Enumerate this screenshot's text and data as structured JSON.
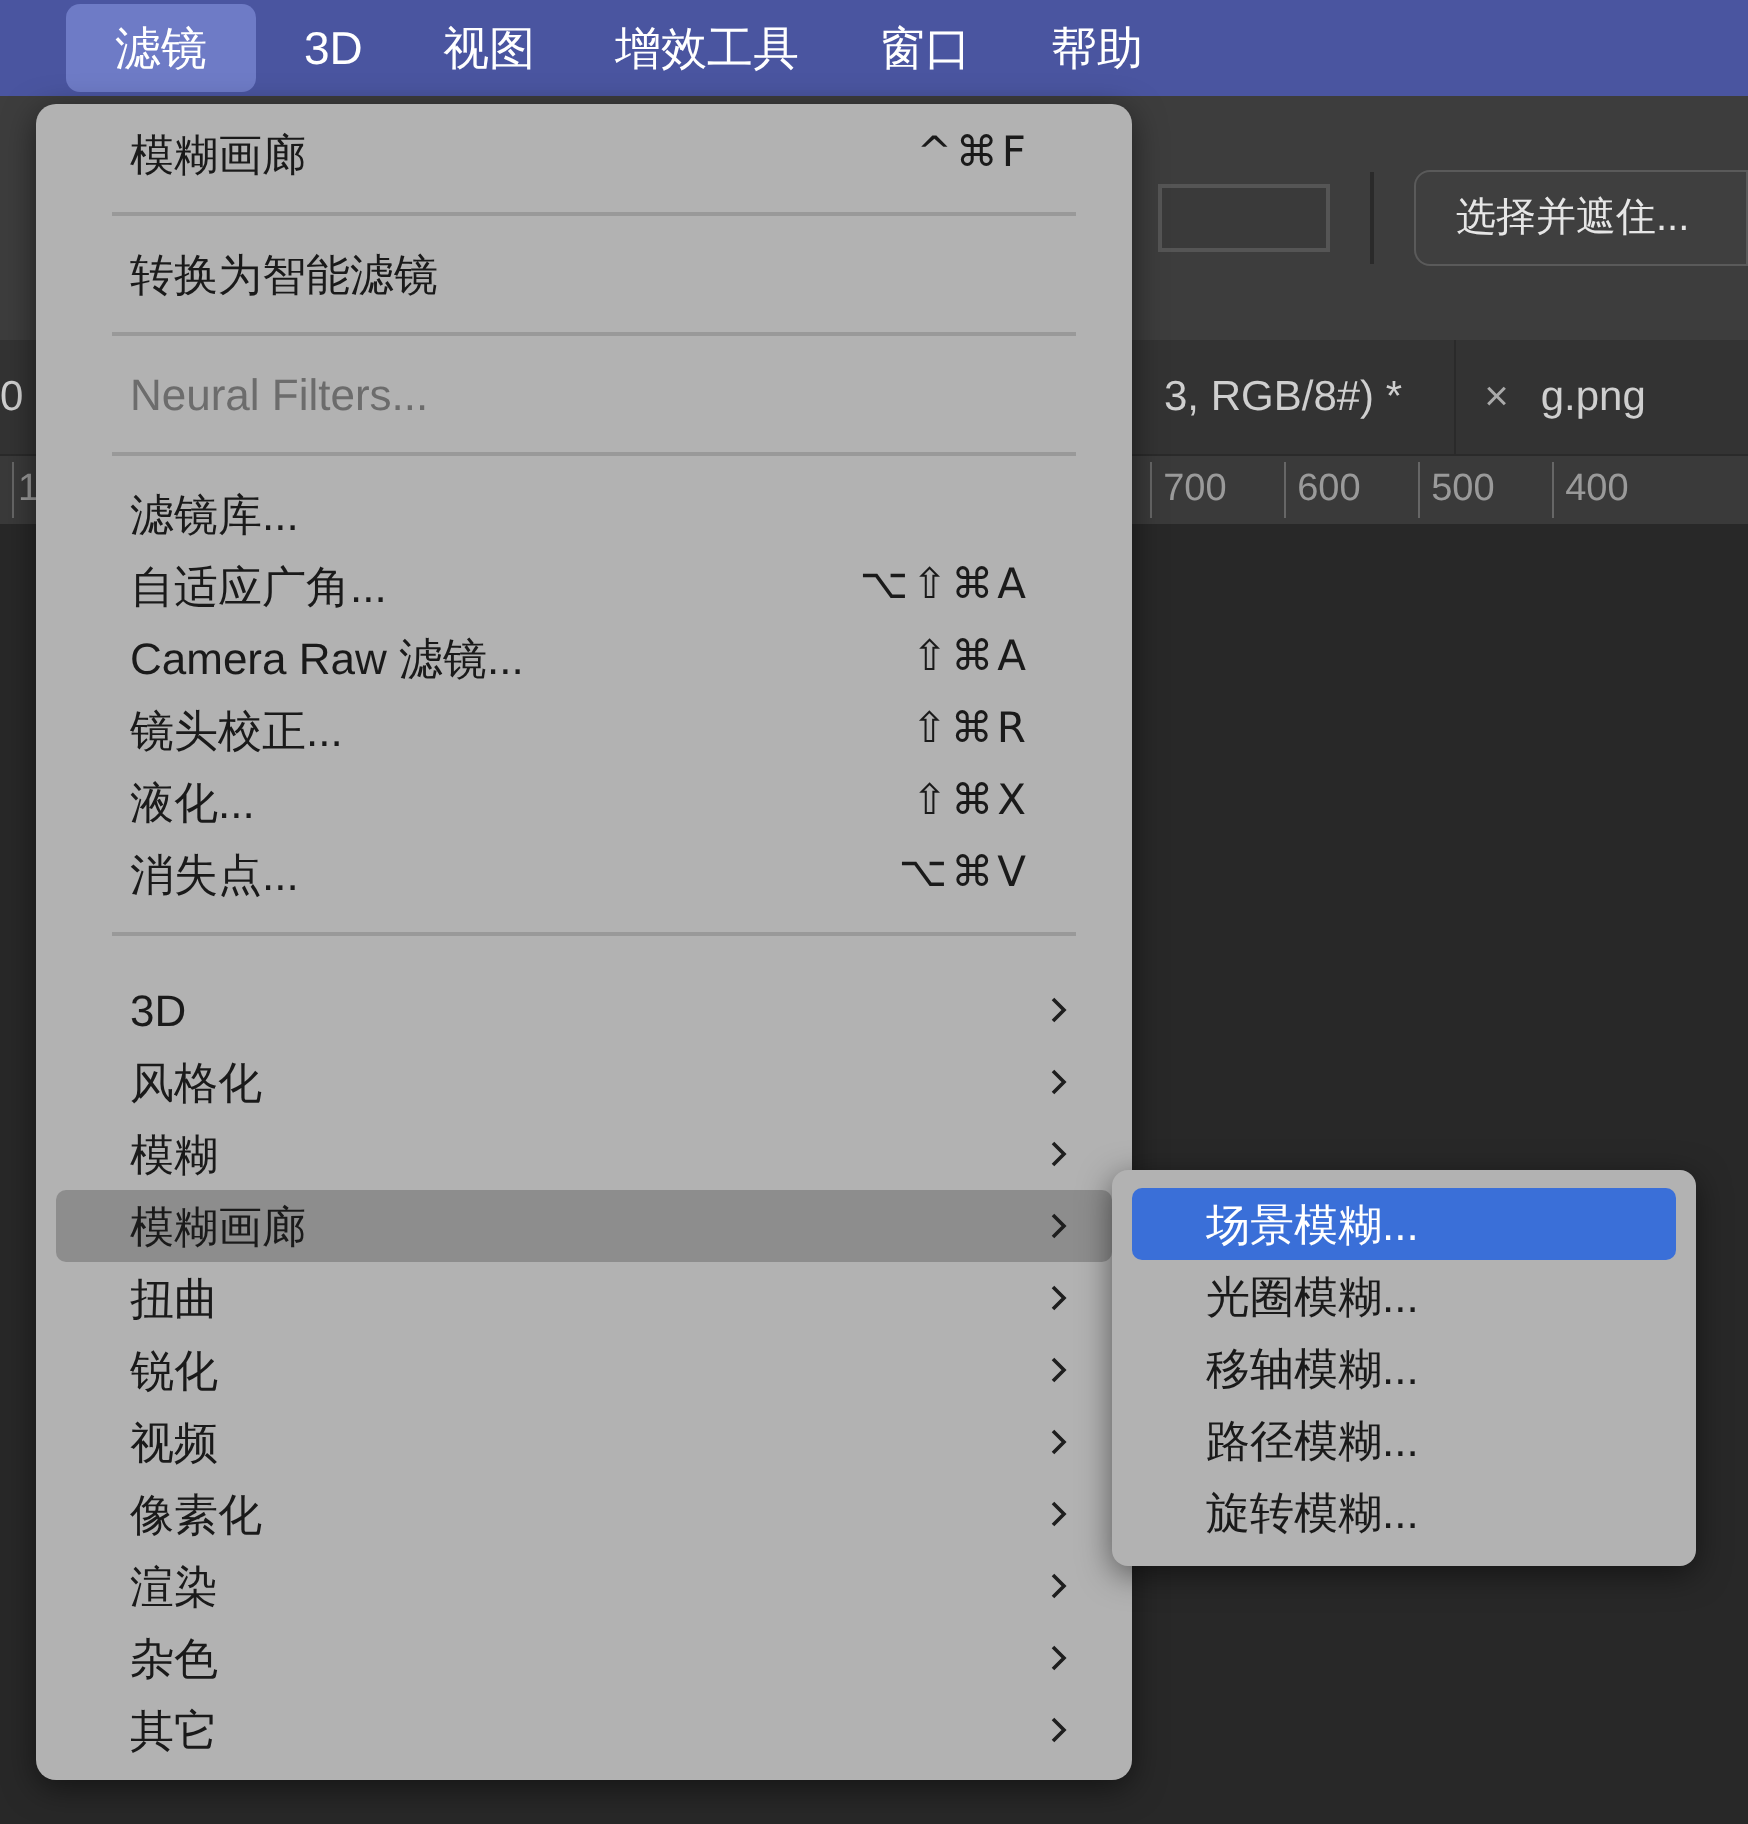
{
  "menu_bar": [
    {
      "label": "滤镜",
      "selected": true
    },
    {
      "label": "3D",
      "selected": false
    },
    {
      "label": "视图",
      "selected": false
    },
    {
      "label": "增效工具",
      "selected": false
    },
    {
      "label": "窗口",
      "selected": false
    },
    {
      "label": "帮助",
      "selected": false
    }
  ],
  "options_bar": {
    "button": "选择并遮住..."
  },
  "document_tabs": [
    {
      "label": "0"
    },
    {
      "label": "3, RGB/8#) *"
    },
    {
      "label": "g.png",
      "close": "×"
    }
  ],
  "ruler": {
    "labels": [
      "1",
      "700",
      "600",
      "500",
      "400"
    ]
  },
  "menu": {
    "sections": [
      [
        {
          "kind": "item",
          "label": "模糊画廊",
          "shortcut": "^⌘F",
          "disabled": false,
          "selected": false
        }
      ],
      [
        {
          "kind": "item",
          "label": "转换为智能滤镜",
          "disabled": false,
          "selected": false
        }
      ],
      [
        {
          "kind": "item",
          "label": "Neural Filters...",
          "disabled": true,
          "selected": false
        }
      ],
      [
        {
          "kind": "item",
          "label": "滤镜库...",
          "disabled": false,
          "selected": false
        },
        {
          "kind": "item",
          "label": "自适应广角...",
          "shortcut": "⌥⇧⌘A",
          "disabled": false,
          "selected": false
        },
        {
          "kind": "item",
          "label": "Camera Raw 滤镜...",
          "shortcut": "⇧⌘A",
          "disabled": false,
          "selected": false
        },
        {
          "kind": "item",
          "label": "镜头校正...",
          "shortcut": "⇧⌘R",
          "disabled": false,
          "selected": false
        },
        {
          "kind": "item",
          "label": "液化...",
          "shortcut": "⇧⌘X",
          "disabled": false,
          "selected": false
        },
        {
          "kind": "item",
          "label": "消失点...",
          "shortcut": "⌥⌘V",
          "disabled": false,
          "selected": false
        }
      ],
      [
        {
          "kind": "submenu",
          "label": "3D",
          "disabled": false,
          "selected": false
        },
        {
          "kind": "submenu",
          "label": "风格化",
          "disabled": false,
          "selected": false
        },
        {
          "kind": "submenu",
          "label": "模糊",
          "disabled": false,
          "selected": false
        },
        {
          "kind": "submenu",
          "label": "模糊画廊",
          "disabled": false,
          "selected": true
        },
        {
          "kind": "submenu",
          "label": "扭曲",
          "disabled": false,
          "selected": false
        },
        {
          "kind": "submenu",
          "label": "锐化",
          "disabled": false,
          "selected": false
        },
        {
          "kind": "submenu",
          "label": "视频",
          "disabled": false,
          "selected": false
        },
        {
          "kind": "submenu",
          "label": "像素化",
          "disabled": false,
          "selected": false
        },
        {
          "kind": "submenu",
          "label": "渲染",
          "disabled": false,
          "selected": false
        },
        {
          "kind": "submenu",
          "label": "杂色",
          "disabled": false,
          "selected": false
        },
        {
          "kind": "submenu",
          "label": "其它",
          "disabled": false,
          "selected": false
        }
      ]
    ]
  },
  "submenu": {
    "items": [
      {
        "label": "场景模糊...",
        "selected": true
      },
      {
        "label": "光圈模糊...",
        "selected": false
      },
      {
        "label": "移轴模糊...",
        "selected": false
      },
      {
        "label": "路径模糊...",
        "selected": false
      },
      {
        "label": "旋转模糊...",
        "selected": false
      }
    ]
  }
}
